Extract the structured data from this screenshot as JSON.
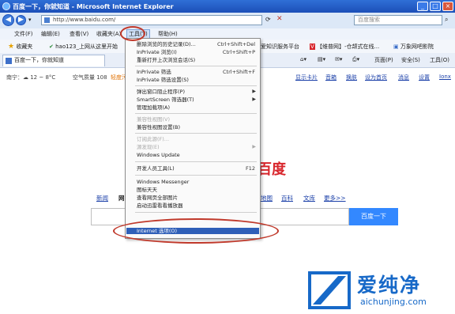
{
  "window": {
    "title": "百度一下，你就知道 - Microsoft Internet Explorer",
    "minimize": "_",
    "maximize": "□",
    "close": "×"
  },
  "address": {
    "url": "http://www.baidu.com/",
    "search_placeholder": "百度搜索"
  },
  "menubar": [
    "文件(F)",
    "编辑(E)",
    "查看(V)",
    "收藏夹(A)",
    "工具(T)",
    "帮助(H)"
  ],
  "favorites": {
    "label": "收藏夹",
    "items": [
      "hao123_上网从这里开始",
      "",
      "爱知识服务平台",
      "【维普网】-仓颉式在线...",
      "万象网吧影院"
    ]
  },
  "tab": {
    "label": "百度一下，你就知道"
  },
  "commands": [
    "页面(P)",
    "安全(S)",
    "工具(O)"
  ],
  "page_info": {
    "weather": "南宁：☁ 12 ~ 8°C",
    "air_label": "空气质量 108",
    "air_status": "轻度污染",
    "links": [
      "显示卡片",
      "音箱",
      "换肤",
      "设为首页",
      "消息",
      "设置",
      "Ionx"
    ]
  },
  "tools_menu": {
    "items": [
      {
        "label": "删除浏览的历史记录(D)...",
        "shortcut": "Ctrl+Shift+Del",
        "disabled": false
      },
      {
        "label": "InPrivate 浏览(I)",
        "shortcut": "Ctrl+Shift+P",
        "disabled": false
      },
      {
        "label": "重新打开上次浏览会话(S)",
        "shortcut": "",
        "disabled": false
      },
      {
        "label": "InPrivate 筛选",
        "shortcut": "Ctrl+Shift+F",
        "disabled": false
      },
      {
        "label": "InPrivate 筛选设置(S)",
        "shortcut": "",
        "disabled": false
      },
      {
        "label": "弹出窗口阻止程序(P)",
        "shortcut": "",
        "disabled": false,
        "submenu": true
      },
      {
        "label": "SmartScreen 筛选器(T)",
        "shortcut": "",
        "disabled": false,
        "submenu": true
      },
      {
        "label": "管理加载项(A)",
        "shortcut": "",
        "disabled": false
      },
      {
        "label": "兼容性视图(V)",
        "shortcut": "",
        "disabled": true
      },
      {
        "label": "兼容性视图设置(B)",
        "shortcut": "",
        "disabled": false
      },
      {
        "label": "订阅此源(F)...",
        "shortcut": "",
        "disabled": true
      },
      {
        "label": "源发现(E)",
        "shortcut": "",
        "disabled": true,
        "submenu": true
      },
      {
        "label": "Windows Update",
        "shortcut": "",
        "disabled": false
      },
      {
        "label": "开发人员工具(L)",
        "shortcut": "F12",
        "disabled": false
      },
      {
        "label": "Windows Messenger",
        "shortcut": "",
        "disabled": false
      },
      {
        "label": "图标天天",
        "shortcut": "",
        "disabled": false
      },
      {
        "label": "查看网页全部图片",
        "shortcut": "",
        "disabled": false
      },
      {
        "label": "启动迅雷看看播放器",
        "shortcut": "",
        "disabled": false
      },
      {
        "label": "Internet 选项(O)",
        "shortcut": "",
        "disabled": false,
        "selected": true
      }
    ]
  },
  "baidu": {
    "logo": "百度",
    "nav": [
      "新闻",
      "网",
      "地图",
      "百科",
      "文库",
      "更多>>"
    ],
    "search_button": "百度一下"
  },
  "watermark": {
    "text": "爱纯净",
    "url": "aichunjing.com"
  },
  "colors": {
    "highlight_oval": "#c0392b",
    "menu_selected": "#2f5fb8",
    "baidu_red": "#d8262c",
    "watermark_blue": "#1769c8"
  }
}
